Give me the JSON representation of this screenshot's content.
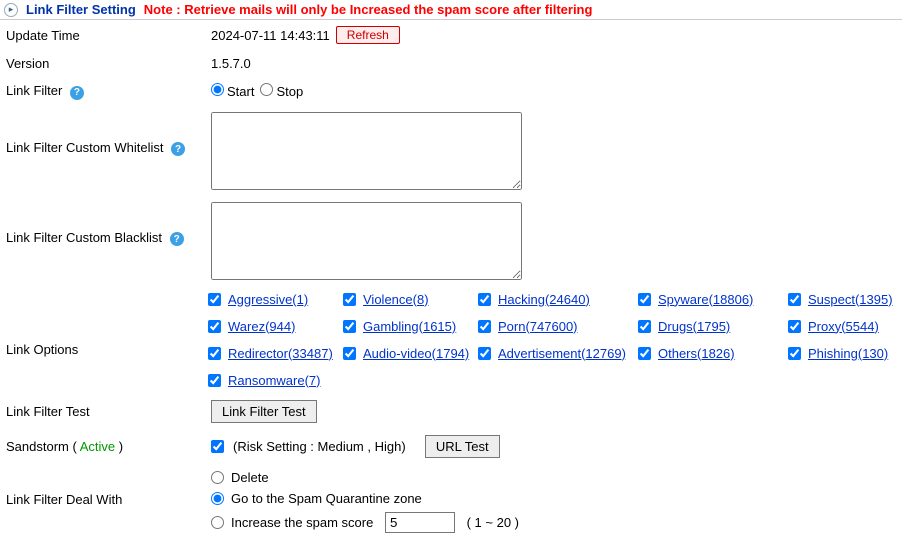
{
  "header": {
    "title": "Link Filter Setting",
    "note": "Note : Retrieve mails will only be Increased the spam score after filtering"
  },
  "labels": {
    "update_time": "Update Time",
    "version": "Version",
    "link_filter": "Link Filter",
    "whitelist": "Link Filter Custom Whitelist",
    "blacklist": "Link Filter Custom Blacklist",
    "link_options": "Link Options",
    "link_filter_test": "Link Filter Test",
    "sandstorm": "Sandstorm",
    "sandstorm_status": "Active",
    "deal_with": "Link Filter Deal With"
  },
  "values": {
    "update_time": "2024-07-11 14:43:11",
    "refresh": "Refresh",
    "version": "1.5.7.0",
    "start": "Start",
    "stop": "Stop",
    "test_btn": "Link Filter Test",
    "url_test": "URL Test",
    "risk_setting": "(Risk Setting : Medium , High)",
    "delete": "Delete",
    "quarantine": "Go to the Spam Quarantine zone",
    "increase": "Increase the spam score",
    "score_val": "5",
    "score_range": "( 1 ~ 20 )"
  },
  "options": [
    {
      "label": "Aggressive(1)"
    },
    {
      "label": "Violence(8)"
    },
    {
      "label": "Hacking(24640)"
    },
    {
      "label": "Spyware(18806)"
    },
    {
      "label": "Suspect(1395)"
    },
    {
      "label": "Warez(944)"
    },
    {
      "label": "Gambling(1615)"
    },
    {
      "label": "Porn(747600)"
    },
    {
      "label": "Drugs(1795)"
    },
    {
      "label": "Proxy(5544)"
    },
    {
      "label": "Redirector(33487)"
    },
    {
      "label": "Audio-video(1794)"
    },
    {
      "label": "Advertisement(12769)"
    },
    {
      "label": "Others(1826)"
    },
    {
      "label": "Phishing(130)"
    },
    {
      "label": "Ransomware(7)"
    }
  ]
}
